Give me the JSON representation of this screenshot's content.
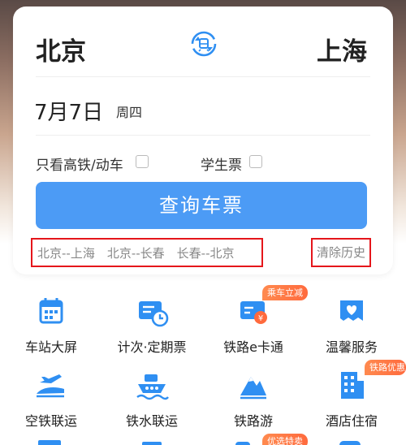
{
  "search": {
    "from_city": "北京",
    "to_city": "上海",
    "date": "7月7日",
    "weekday": "周四",
    "options": [
      {
        "label": "只看高铁/动车",
        "checked": false
      },
      {
        "label": "学生票",
        "checked": false
      }
    ],
    "query_button": "查询车票",
    "history": [
      "北京--上海",
      "北京--长春",
      "长春--北京"
    ],
    "clear_history": "清除历史"
  },
  "services": [
    {
      "label": "车站大屏",
      "icon": "station-screen-icon",
      "badge": ""
    },
    {
      "label": "计次·定期票",
      "icon": "period-ticket-icon",
      "badge": ""
    },
    {
      "label": "铁路e卡通",
      "icon": "e-card-icon",
      "badge": "乘车立减"
    },
    {
      "label": "温馨服务",
      "icon": "care-service-icon",
      "badge": ""
    },
    {
      "label": "空铁联运",
      "icon": "air-rail-icon",
      "badge": ""
    },
    {
      "label": "铁水联运",
      "icon": "rail-water-icon",
      "badge": ""
    },
    {
      "label": "铁路游",
      "icon": "rail-tour-icon",
      "badge": ""
    },
    {
      "label": "酒店住宿",
      "icon": "hotel-icon",
      "badge": "铁路优惠"
    }
  ],
  "partial_row_badge": "优选特卖",
  "colors": {
    "primary": "#4c9bf5",
    "icon_blue": "#2f8ff2",
    "badge_orange": "#ff7a45",
    "highlight_red": "#e5161b"
  }
}
